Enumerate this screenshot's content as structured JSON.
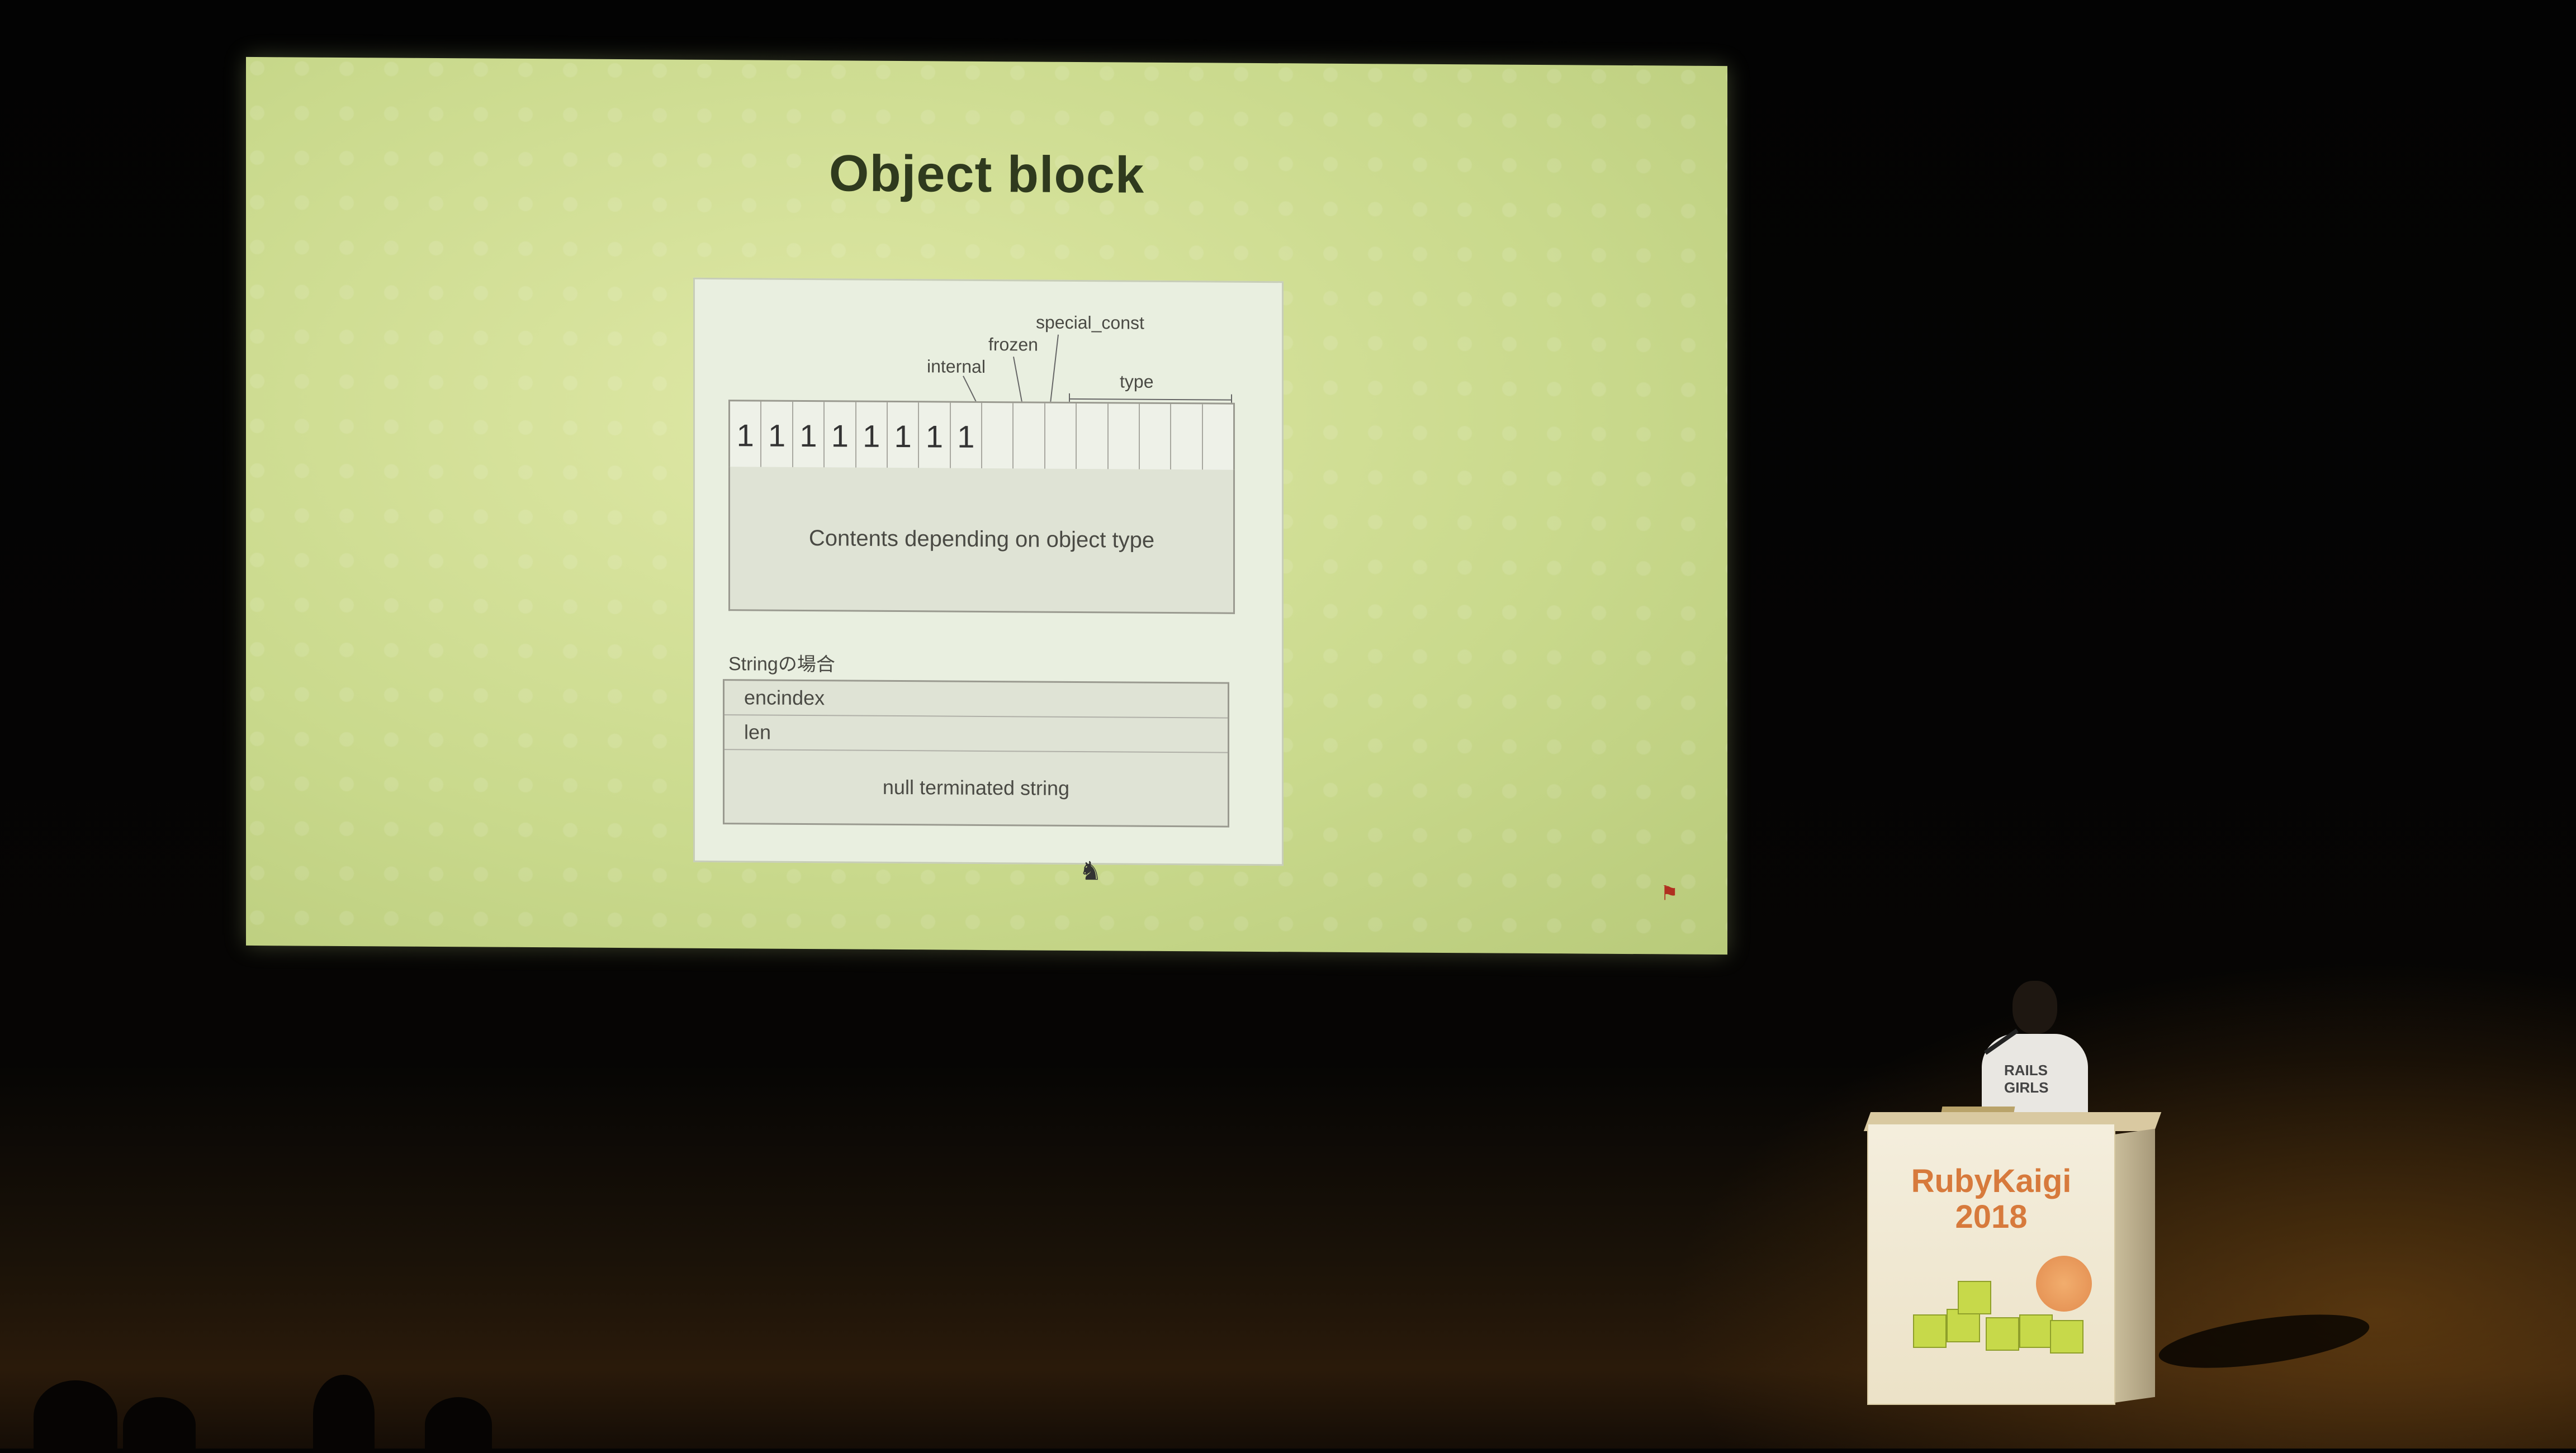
{
  "slide": {
    "title": "Object block",
    "diagram": {
      "labels": {
        "special_const": "special_const",
        "frozen": "frozen",
        "internal": "internal",
        "type": "type"
      },
      "bits": [
        "1",
        "1",
        "1",
        "1",
        "1",
        "1",
        "1",
        "1"
      ],
      "contents": "Contents depending on object type"
    },
    "string_section": {
      "caption": "Stringの場合",
      "rows": [
        "encindex",
        "len",
        "null terminated string"
      ]
    }
  },
  "podium": {
    "name": "RubyKaigi",
    "year": "2018"
  },
  "speaker": {
    "shirt_text": "RAILS GIRLS"
  }
}
